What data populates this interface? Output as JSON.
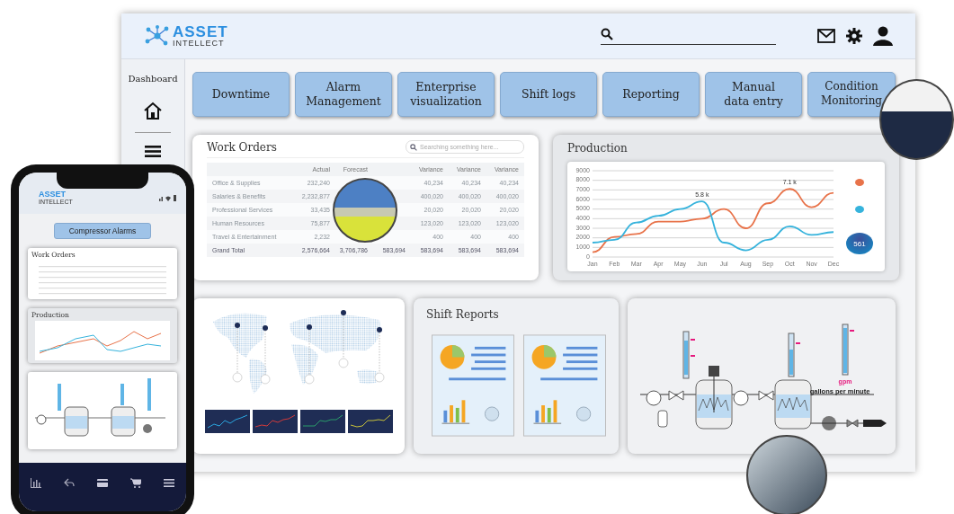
{
  "header": {
    "logo_top": "ASSET",
    "logo_bottom": "INTELLECT"
  },
  "sidebar": {
    "items": [
      {
        "label": "Dashboard"
      }
    ]
  },
  "tiles": [
    {
      "lines": [
        "Downtime"
      ]
    },
    {
      "lines": [
        "Alarm",
        "Management"
      ]
    },
    {
      "lines": [
        "Enterprise",
        "visualization"
      ]
    },
    {
      "lines": [
        "Shift logs"
      ]
    },
    {
      "lines": [
        "Reporting"
      ]
    },
    {
      "lines": [
        "Manual",
        "data entry"
      ]
    },
    {
      "lines": [
        "Condition",
        "Monitoring"
      ]
    }
  ],
  "work_orders": {
    "title": "Work Orders",
    "search": {
      "placeholder": "Searching something here..."
    },
    "columns": [
      "",
      "Actual",
      "Forecast",
      "",
      "Variance",
      "Variance",
      "Variance"
    ],
    "rows": [
      {
        "cells": [
          "Office & Supplies",
          "232,240",
          "",
          "",
          "40,234",
          "40,234",
          "40,234"
        ]
      },
      {
        "cells": [
          "Salaries & Benefits",
          "2,232,877",
          "",
          "",
          "400,020",
          "400,020",
          "400,020"
        ]
      },
      {
        "cells": [
          "Professional Services",
          "33,435",
          "",
          "",
          "20,020",
          "20,020",
          "20,020"
        ]
      },
      {
        "cells": [
          "Human Resources",
          "75,877",
          "",
          "",
          "123,020",
          "123,020",
          "123,020"
        ]
      },
      {
        "cells": [
          "Travel & Entertainment",
          "2,232",
          "",
          "",
          "400",
          "400",
          "400"
        ]
      },
      {
        "cells": [
          "Grand Total",
          "2,576,664",
          "3,706,786",
          "583,694",
          "583,694",
          "583,694",
          "583,694"
        ]
      }
    ]
  },
  "production": {
    "title": "Production",
    "badge": "561",
    "chart_data": {
      "type": "line",
      "grid": true,
      "categories": [
        "Jan",
        "Feb",
        "Mar",
        "Apr",
        "May",
        "Jun",
        "Jul",
        "Aug",
        "Sep",
        "Oct",
        "Nov",
        "Dec"
      ],
      "ylim": [
        0,
        9000
      ],
      "yticks": [
        0,
        1000,
        2000,
        3000,
        4000,
        5000,
        6000,
        7000,
        8000,
        9000
      ],
      "series": [
        {
          "color": "#e8734a",
          "values": [
            500,
            2100,
            2400,
            3700,
            3700,
            4000,
            5000,
            3000,
            5600,
            7100,
            5200,
            6700
          ]
        },
        {
          "color": "#36b3dc",
          "values": [
            1500,
            1800,
            3600,
            4300,
            5000,
            5800,
            1500,
            700,
            1800,
            3200,
            2300,
            2600
          ]
        }
      ],
      "annotations": [
        "5.8 k",
        "7.1 k"
      ]
    }
  },
  "shift_reports": {
    "title": "Shift Reports"
  },
  "process": {
    "unit": "gpm",
    "caption": "gallons per minute"
  },
  "phone": {
    "logo_top": "ASSET",
    "logo_bottom": "INTELLECT",
    "button": "Compressor Alarms",
    "cards": [
      {
        "kind": "table",
        "title": "Work Orders"
      },
      {
        "kind": "chart",
        "title": "Production"
      },
      {
        "kind": "diagram"
      }
    ]
  }
}
